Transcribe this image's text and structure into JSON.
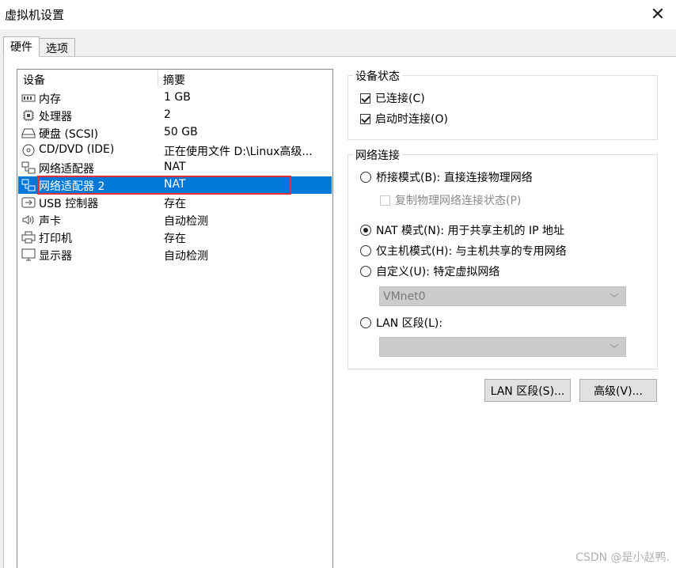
{
  "window": {
    "title": "虚拟机设置",
    "close_icon": "close-icon"
  },
  "tabs": [
    {
      "label": "硬件",
      "active": true
    },
    {
      "label": "选项",
      "active": false
    }
  ],
  "device_list": {
    "columns": {
      "device": "设备",
      "summary": "摘要"
    },
    "rows": [
      {
        "icon": "memory-icon",
        "name": "内存",
        "summary": "1 GB"
      },
      {
        "icon": "processor-icon",
        "name": "处理器",
        "summary": "2"
      },
      {
        "icon": "hard-disk-icon",
        "name": "硬盘 (SCSI)",
        "summary": "50 GB"
      },
      {
        "icon": "cd-dvd-icon",
        "name": "CD/DVD (IDE)",
        "summary": "正在使用文件 D:\\Linux高级..."
      },
      {
        "icon": "network-adapter-icon",
        "name": "网络适配器",
        "summary": "NAT"
      },
      {
        "icon": "network-adapter-icon",
        "name": "网络适配器 2",
        "summary": "NAT",
        "selected": true
      },
      {
        "icon": "usb-icon",
        "name": "USB 控制器",
        "summary": "存在"
      },
      {
        "icon": "speaker-icon",
        "name": "声卡",
        "summary": "自动检测"
      },
      {
        "icon": "printer-icon",
        "name": "打印机",
        "summary": "存在"
      },
      {
        "icon": "monitor-icon",
        "name": "显示器",
        "summary": "自动检测"
      }
    ]
  },
  "device_status": {
    "title": "设备状态",
    "connected": {
      "label": "已连接(C)",
      "checked": true
    },
    "connect_at_power_on": {
      "label": "启动时连接(O)",
      "checked": true
    }
  },
  "network_connection": {
    "title": "网络连接",
    "bridged": {
      "label": "桥接模式(B): 直接连接物理网络",
      "checked": false
    },
    "replicate": {
      "label": "复制物理网络连接状态(P)",
      "checked": false
    },
    "nat": {
      "label": "NAT 模式(N): 用于共享主机的 IP 地址",
      "checked": true
    },
    "host_only": {
      "label": "仅主机模式(H): 与主机共享的专用网络",
      "checked": false
    },
    "custom": {
      "label": "自定义(U): 特定虚拟网络",
      "checked": false
    },
    "custom_select_value": "VMnet0",
    "lan_segment": {
      "label": "LAN 区段(L):",
      "checked": false
    },
    "lan_select_value": ""
  },
  "buttons": {
    "lan_segments": "LAN 区段(S)...",
    "advanced": "高级(V)..."
  },
  "watermark": "CSDN @是小赵鸭.",
  "colors": {
    "selection": "#0078d7",
    "highlight_box": "#e0303a"
  }
}
